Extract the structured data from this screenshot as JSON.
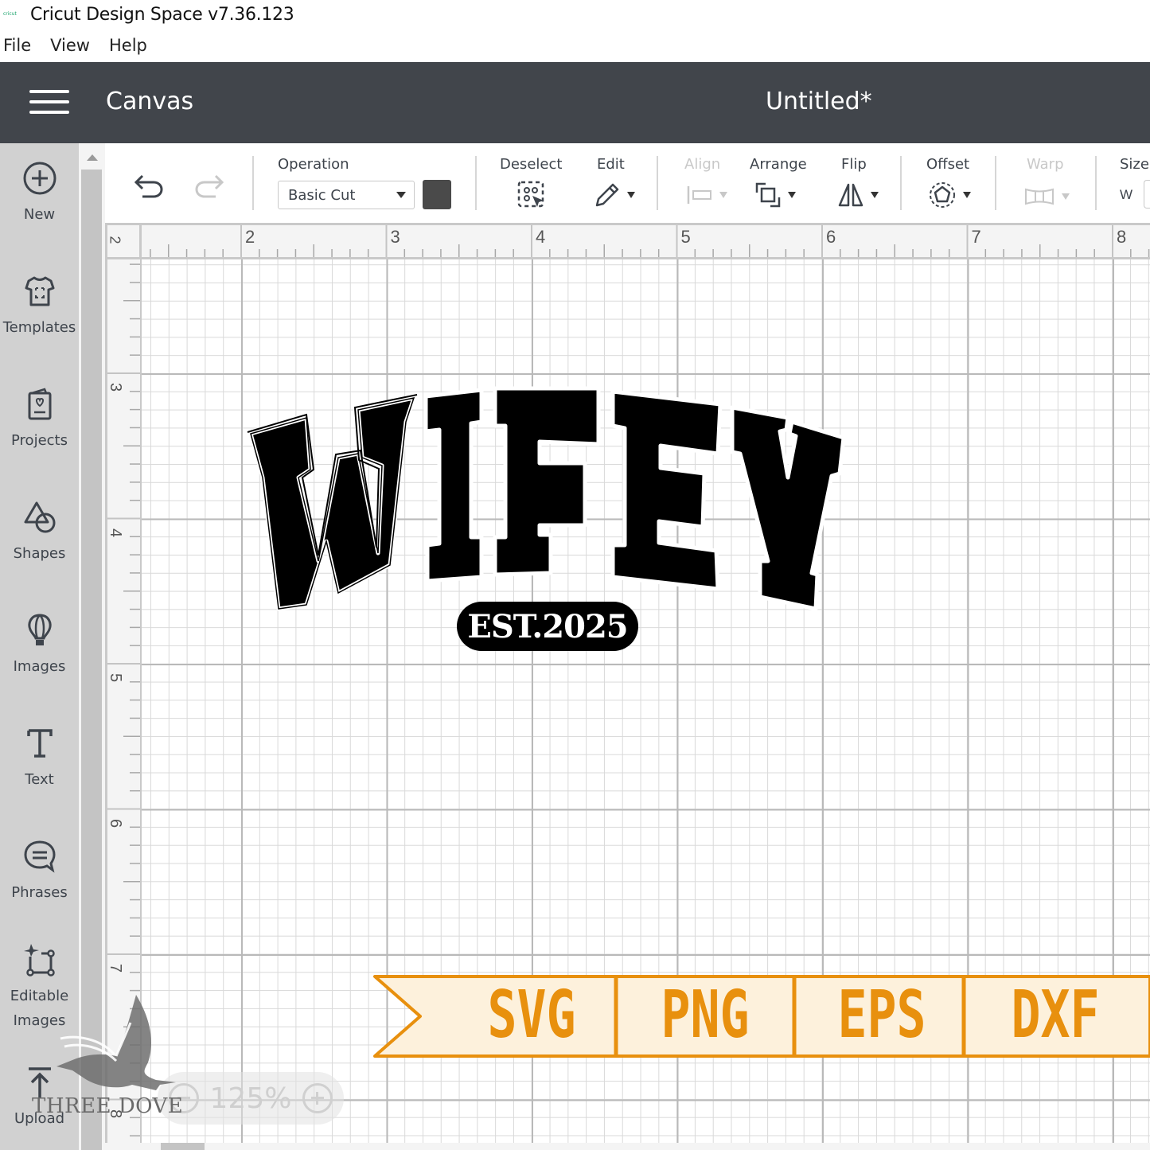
{
  "window": {
    "app_icon": "cricut",
    "title": "Cricut Design Space  v7.36.123"
  },
  "menubar": {
    "items": [
      "File",
      "View",
      "Help"
    ]
  },
  "header": {
    "menu_icon": "hamburger-icon",
    "section": "Canvas",
    "document_title": "Untitled*"
  },
  "leftnav": {
    "items": [
      {
        "label": "New",
        "icon": "plus-circle-icon"
      },
      {
        "label": "Templates",
        "icon": "tshirt-icon"
      },
      {
        "label": "Projects",
        "icon": "card-heart-icon"
      },
      {
        "label": "Shapes",
        "icon": "shapes-icon"
      },
      {
        "label": "Images",
        "icon": "balloon-icon"
      },
      {
        "label": "Text",
        "icon": "text-icon"
      },
      {
        "label": "Phrases",
        "icon": "speech-bubble-icon"
      },
      {
        "label": "Editable\nImages",
        "label_line1": "Editable",
        "label_line2": "Images",
        "icon": "editable-image-icon"
      },
      {
        "label": "Upload",
        "icon": "upload-icon"
      }
    ]
  },
  "toolbar": {
    "undo": "undo-icon",
    "redo": "redo-icon",
    "operation_label": "Operation",
    "operation_value": "Basic Cut",
    "operation_color": "#4a4a4a",
    "deselect_label": "Deselect",
    "edit_label": "Edit",
    "align_label": "Align",
    "arrange_label": "Arrange",
    "flip_label": "Flip",
    "offset_label": "Offset",
    "warp_label": "Warp",
    "size_label": "Size",
    "size_w_label": "W",
    "disabled": [
      "Align",
      "Warp"
    ]
  },
  "rulers": {
    "horizontal": [
      "2",
      "3",
      "4",
      "5",
      "6",
      "7",
      "8"
    ],
    "vertical": [
      "2",
      "3",
      "4",
      "5",
      "6",
      "7",
      "8"
    ]
  },
  "design": {
    "main_text": "WIFEY",
    "sub_text": "EST.2025",
    "fill": "#000000",
    "outline": "#ffffff"
  },
  "banner": {
    "formats": [
      "SVG",
      "PNG",
      "EPS",
      "DXF"
    ],
    "accent": "#e8900e",
    "background": "#fdf1dc"
  },
  "zoom": {
    "value": "125%"
  },
  "watermark": {
    "text": "THREE DOVE"
  }
}
